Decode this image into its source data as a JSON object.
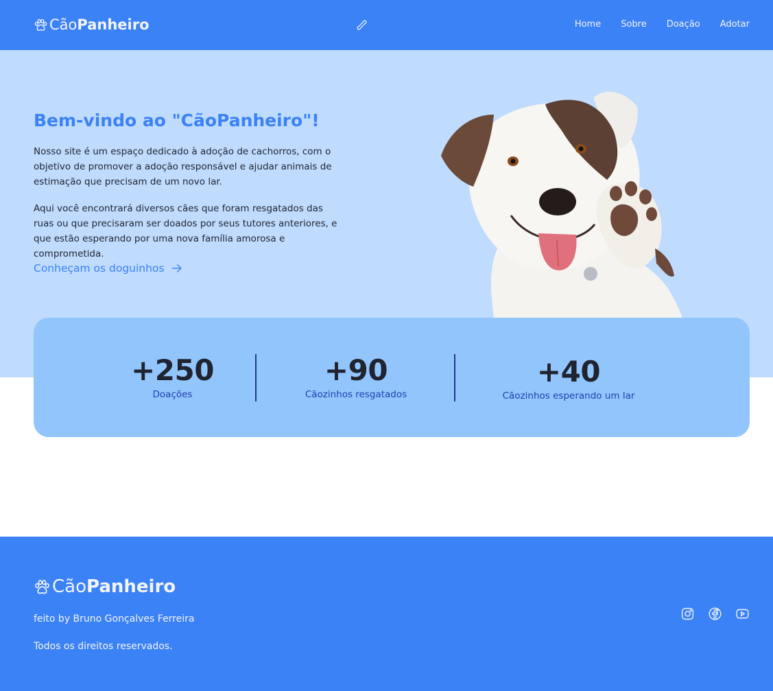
{
  "header": {
    "logo_light": "Cão",
    "logo_bold": "Panheiro",
    "nav": [
      "Home",
      "Sobre",
      "Doação",
      "Adotar"
    ]
  },
  "hero": {
    "title": "Bem-vindo ao \"CãoPanheiro\"!",
    "paragraph1": "Nosso site é um espaço dedicado à adoção de cachorros, com o objetivo de promover a adoção responsável e ajudar animais de estimação que precisam de um novo lar.",
    "paragraph2": "Aqui você encontrará diversos cães que foram resgatados das ruas ou que precisaram ser doados por seus tutores anteriores, e que estão esperando por uma nova família amorosa e comprometida.",
    "cta": "Conheçam os doguinhos"
  },
  "stats": [
    {
      "value": "+250",
      "label": "Doações"
    },
    {
      "value": "+90",
      "label": "Cãozinhos resgatados"
    },
    {
      "value": "+40",
      "label": "Cãozinhos esperando um lar"
    }
  ],
  "footer": {
    "logo_light": "Cão",
    "logo_bold": "Panheiro",
    "credit": "feito by Bruno Gonçalves Ferreira",
    "rights": "Todos os direitos reservados."
  },
  "icons": {
    "logo": "paw-icon",
    "center": "bone-icon",
    "cta": "arrow-right-icon",
    "social": [
      "instagram-icon",
      "facebook-icon",
      "youtube-icon"
    ]
  },
  "colors": {
    "brand": "#3b82f6",
    "hero_bg": "#bfdbfe",
    "stats_bg": "#93c5fd",
    "stat_label": "#1e40af"
  }
}
